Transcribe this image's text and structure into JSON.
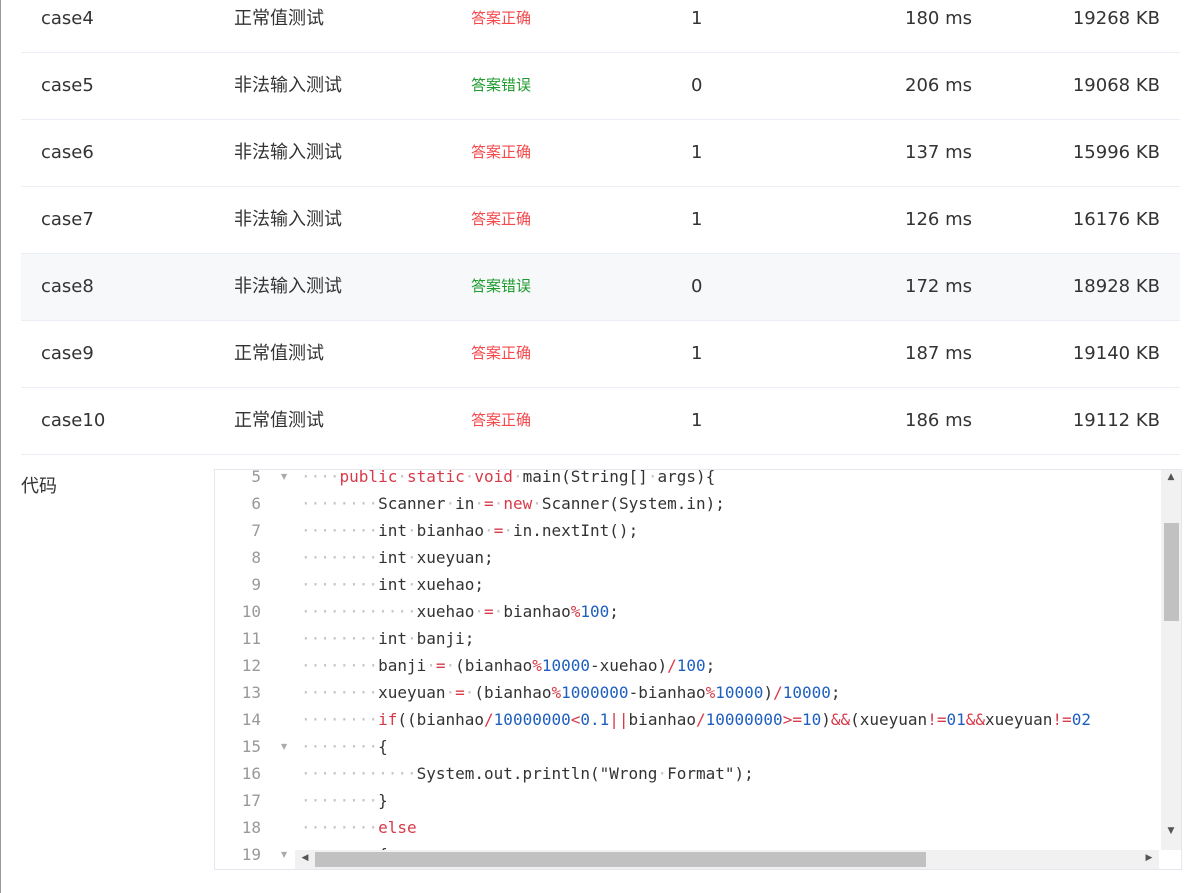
{
  "table": {
    "rows": [
      {
        "name": "case4",
        "type": "正常值测试",
        "result": "答案正确",
        "status": "ok",
        "score": "1",
        "time": "180 ms",
        "memory": "19268 KB"
      },
      {
        "name": "case5",
        "type": "非法输入测试",
        "result": "答案错误",
        "status": "err",
        "score": "0",
        "time": "206 ms",
        "memory": "19068 KB"
      },
      {
        "name": "case6",
        "type": "非法输入测试",
        "result": "答案正确",
        "status": "ok",
        "score": "1",
        "time": "137 ms",
        "memory": "15996 KB"
      },
      {
        "name": "case7",
        "type": "非法输入测试",
        "result": "答案正确",
        "status": "ok",
        "score": "1",
        "time": "126 ms",
        "memory": "16176 KB"
      },
      {
        "name": "case8",
        "type": "非法输入测试",
        "result": "答案错误",
        "status": "err",
        "score": "0",
        "time": "172 ms",
        "memory": "18928 KB"
      },
      {
        "name": "case9",
        "type": "正常值测试",
        "result": "答案正确",
        "status": "ok",
        "score": "1",
        "time": "187 ms",
        "memory": "19140 KB"
      },
      {
        "name": "case10",
        "type": "正常值测试",
        "result": "答案正确",
        "status": "ok",
        "score": "1",
        "time": "186 ms",
        "memory": "19112 KB"
      }
    ]
  },
  "code": {
    "label": "代码",
    "lines": [
      {
        "n": "5",
        "fold": true,
        "indent": 4,
        "text": "public static void main(String[] args){"
      },
      {
        "n": "6",
        "fold": false,
        "indent": 8,
        "text": "Scanner in = new Scanner(System.in);"
      },
      {
        "n": "7",
        "fold": false,
        "indent": 8,
        "text": "int bianhao = in.nextInt();"
      },
      {
        "n": "8",
        "fold": false,
        "indent": 8,
        "text": "int xueyuan;"
      },
      {
        "n": "9",
        "fold": false,
        "indent": 8,
        "text": "int xuehao;"
      },
      {
        "n": "10",
        "fold": false,
        "indent": 12,
        "text": "xuehao = bianhao%100;"
      },
      {
        "n": "11",
        "fold": false,
        "indent": 8,
        "text": "int banji;"
      },
      {
        "n": "12",
        "fold": false,
        "indent": 8,
        "text": "banji = (bianhao%10000-xuehao)/100;"
      },
      {
        "n": "13",
        "fold": false,
        "indent": 8,
        "text": "xueyuan = (bianhao%1000000-bianhao%10000)/10000;"
      },
      {
        "n": "14",
        "fold": false,
        "indent": 8,
        "text": "if((bianhao/10000000<0.1||bianhao/10000000>=10)&&(xueyuan!=01&&xueyuan!=02"
      },
      {
        "n": "15",
        "fold": true,
        "indent": 8,
        "text": "{"
      },
      {
        "n": "16",
        "fold": false,
        "indent": 12,
        "text": "System.out.println(\"Wrong Format\");"
      },
      {
        "n": "17",
        "fold": false,
        "indent": 8,
        "text": "}"
      },
      {
        "n": "18",
        "fold": false,
        "indent": 8,
        "text": "else"
      },
      {
        "n": "19",
        "fold": true,
        "indent": 8,
        "text": "{"
      }
    ]
  },
  "colors": {
    "correct": "#f5484b",
    "wrong": "#1f9b2e",
    "keyword": "#d73a49",
    "number": "#1f5fc0"
  }
}
